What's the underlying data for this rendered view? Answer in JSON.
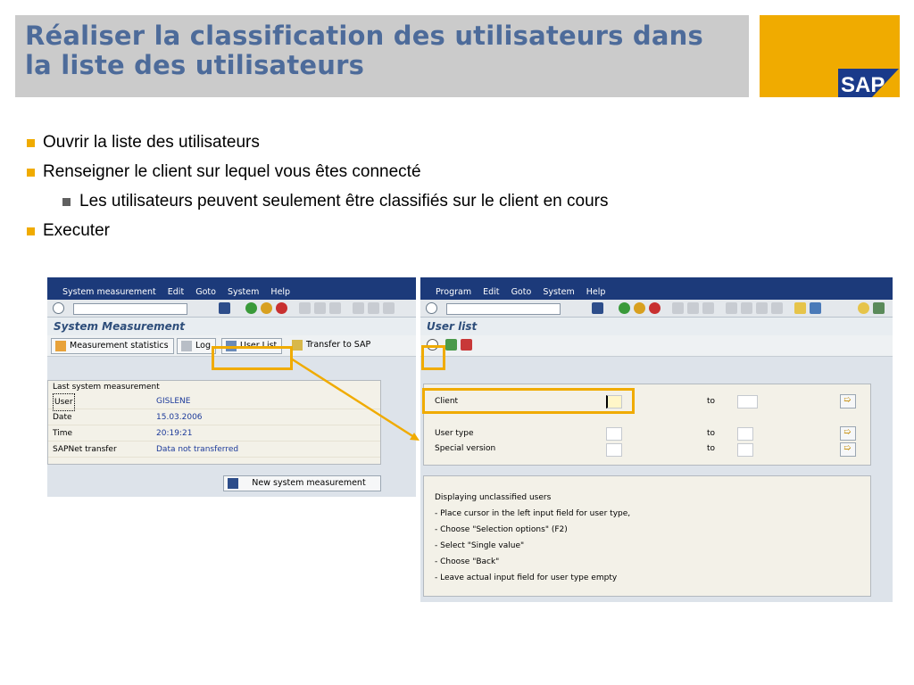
{
  "slide": {
    "title": "Réaliser la classification des utilisateurs dans la liste des utilisateurs",
    "logo": "SAP",
    "bullets": [
      "Ouvrir la liste des utilisateurs",
      "Renseigner le client sur lequel vous êtes connecté",
      "Les utilisateurs peuvent seulement être classifiés sur le client en cours",
      "Executer"
    ]
  },
  "left_window": {
    "menu": [
      "System measurement",
      "Edit",
      "Goto",
      "System",
      "Help"
    ],
    "screen_title": "System Measurement",
    "buttons": {
      "stats": "Measurement statistics",
      "log": "Log",
      "user_list": "User List",
      "transfer": "Transfer to SAP",
      "new": "New system measurement"
    },
    "group_title": "Last system measurement",
    "rows": [
      {
        "label": "User",
        "value": "GISLENE"
      },
      {
        "label": "Date",
        "value": "15.03.2006"
      },
      {
        "label": "Time",
        "value": "20:19:21"
      },
      {
        "label": "SAPNet transfer",
        "value": "Data not transferred"
      }
    ]
  },
  "right_window": {
    "menu": [
      "Program",
      "Edit",
      "Goto",
      "System",
      "Help"
    ],
    "screen_title": "User list",
    "fields": {
      "client": "Client",
      "user_type": "User type",
      "special_version": "Special version",
      "to": "to"
    },
    "notes": [
      "Displaying unclassified users",
      "- Place cursor in the left input field for user type,",
      "- Choose \"Selection options\" (F2)",
      "- Select \"Single value\"",
      "- Choose \"Back\"",
      "- Leave actual input field for user type empty"
    ]
  },
  "colors": {
    "accent": "#f0ab00",
    "title": "#4d6b9a",
    "menubar": "#1c3a7a"
  }
}
